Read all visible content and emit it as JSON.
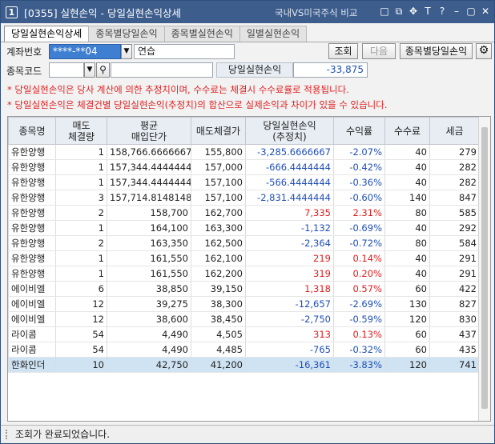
{
  "window": {
    "badge": "1",
    "title": "[0355] 실현손익 - 당일실현손익상세",
    "subtitle": "국내VS미국주식 비교",
    "controls": [
      "□",
      "⧉",
      "✥",
      "T",
      "?",
      "–",
      "▢",
      "✕"
    ]
  },
  "tabs": [
    "당일실현손익상세",
    "종목별당일손익",
    "종목별실현손익",
    "일별실현손익"
  ],
  "form": {
    "account_label": "계좌번호",
    "account_value": "****-**04",
    "account_name": "연습",
    "inquiry_button": "조회",
    "next_button": "다음",
    "by_stock_button": "종목별당일손익",
    "code_label": "종목코드",
    "code_value": "",
    "code_name": "",
    "realized_label": "당일실현손익",
    "realized_value": "-33,875"
  },
  "notices": [
    "* 당일실현손익은 당사 계산에 의한 추정치이며, 수수료는 체결시 수수료률로 적용됩니다.",
    "* 당일실현손익은 체결건별 당일실현손익(추정치)의 합산으로 실제손익과 차이가 있을 수 있습니다."
  ],
  "table": {
    "headers": [
      "종목명",
      "매도\n체결량",
      "평균\n매입단가",
      "매도체결가",
      "당일실현손익\n(추정치)",
      "수익률",
      "수수료",
      "세금"
    ],
    "rows": [
      [
        "유한양행",
        "1",
        "158,766.6666667",
        "155,800",
        "-3,285.6666667",
        "-2.07%",
        "40",
        "279"
      ],
      [
        "유한양행",
        "1",
        "157,344.4444444",
        "157,000",
        "-666.4444444",
        "-0.42%",
        "40",
        "282"
      ],
      [
        "유한양행",
        "1",
        "157,344.4444444",
        "157,100",
        "-566.4444444",
        "-0.36%",
        "40",
        "282"
      ],
      [
        "유한양행",
        "3",
        "157,714.8148148",
        "157,100",
        "-2,831.4444444",
        "-0.60%",
        "140",
        "847"
      ],
      [
        "유한양행",
        "2",
        "158,700",
        "162,700",
        "7,335",
        "2.31%",
        "80",
        "585"
      ],
      [
        "유한양행",
        "1",
        "164,100",
        "163,300",
        "-1,132",
        "-0.69%",
        "40",
        "292"
      ],
      [
        "유한양행",
        "2",
        "163,350",
        "162,500",
        "-2,364",
        "-0.72%",
        "80",
        "584"
      ],
      [
        "유한양행",
        "1",
        "161,550",
        "162,100",
        "219",
        "0.14%",
        "40",
        "291"
      ],
      [
        "유한양행",
        "1",
        "161,550",
        "162,200",
        "319",
        "0.20%",
        "40",
        "291"
      ],
      [
        "에이비엘",
        "6",
        "38,850",
        "39,150",
        "1,318",
        "0.57%",
        "60",
        "422"
      ],
      [
        "에이비엘",
        "12",
        "39,275",
        "38,300",
        "-12,657",
        "-2.69%",
        "130",
        "827"
      ],
      [
        "에이비엘",
        "12",
        "38,600",
        "38,450",
        "-2,750",
        "-0.59%",
        "120",
        "830"
      ],
      [
        "라이콤",
        "54",
        "4,490",
        "4,505",
        "313",
        "0.13%",
        "60",
        "437"
      ],
      [
        "라이콤",
        "54",
        "4,490",
        "4,485",
        "-765",
        "-0.32%",
        "60",
        "435"
      ],
      [
        "한화인더",
        "10",
        "42,750",
        "41,200",
        "-16,361",
        "-3.83%",
        "120",
        "741"
      ]
    ],
    "selected_row": 14
  },
  "status": {
    "message": "조회가 완료되었습니다."
  },
  "colors": {
    "titlebar": "#3d5d8c",
    "negative": "#1f4fb5",
    "positive": "#e02020",
    "selected_row": "#cfe3f3"
  }
}
